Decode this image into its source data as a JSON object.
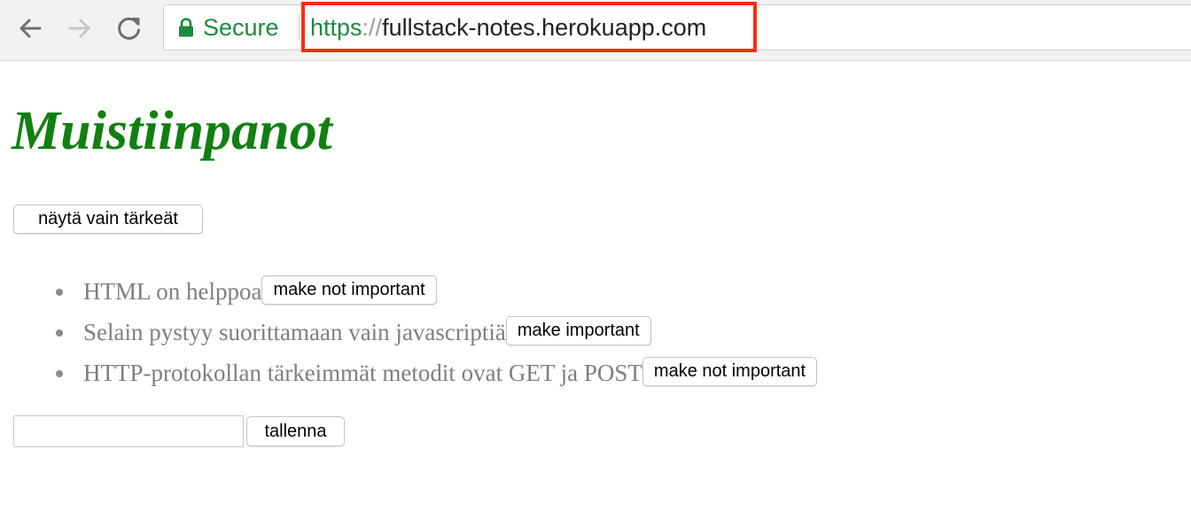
{
  "browser": {
    "secure_label": "Secure",
    "url_scheme": "https",
    "url_separator": "://",
    "url_host": "fullstack-notes.herokuapp.com",
    "highlight_color": "#ff2a12",
    "secure_color": "#1e8a3e"
  },
  "page": {
    "title": "Muistiinpanot",
    "title_color": "#118011",
    "toggle_label": "näytä vain tärkeät",
    "notes": [
      {
        "content": "HTML on helppoa",
        "button_label": "make not important"
      },
      {
        "content": "Selain pystyy suorittamaan vain javascriptiä",
        "button_label": "make important"
      },
      {
        "content": "HTTP-protokollan tärkeimmät metodit ovat GET ja POST",
        "button_label": "make not important"
      }
    ],
    "new_note_value": "",
    "save_label": "tallenna"
  },
  "icons": {
    "back": "arrow-left-icon",
    "forward": "arrow-right-icon",
    "reload": "reload-icon",
    "secure": "lock-icon"
  }
}
